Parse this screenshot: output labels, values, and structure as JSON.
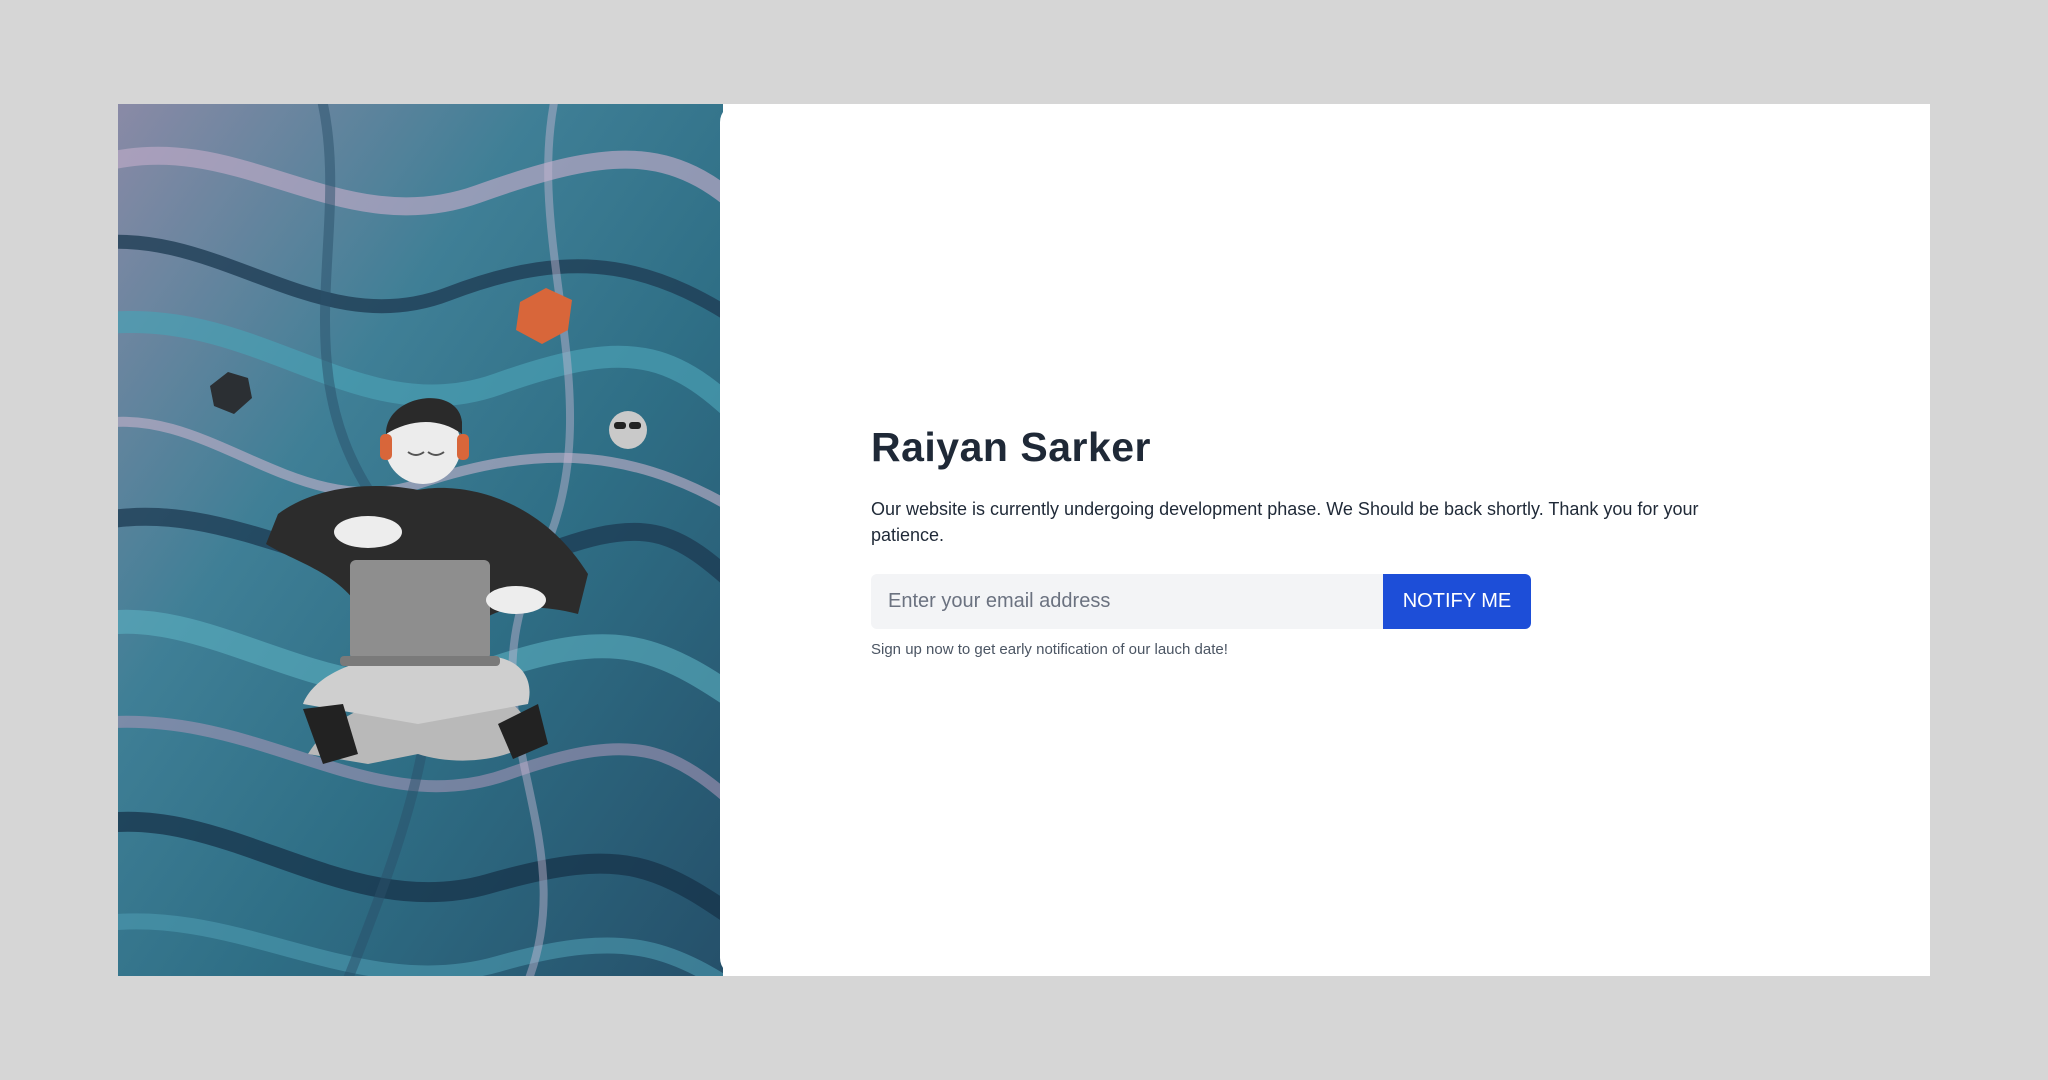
{
  "heading": "Raiyan Sarker",
  "description": "Our website is currently undergoing development phase. We Should be back shortly. Thank you for your patience.",
  "signup": {
    "email_placeholder": "Enter your email address",
    "email_value": "",
    "button_label": "NOTIFY ME",
    "note": "Sign up now to get early notification of our lauch date!"
  },
  "colors": {
    "background": "#d6d6d6",
    "card": "#ffffff",
    "heading": "#1f2937",
    "button": "#1d4ed8",
    "input_bg": "#f3f4f6"
  },
  "illustration": {
    "subject": "person-with-laptop-illustration",
    "background": "marbled-paint-art"
  }
}
